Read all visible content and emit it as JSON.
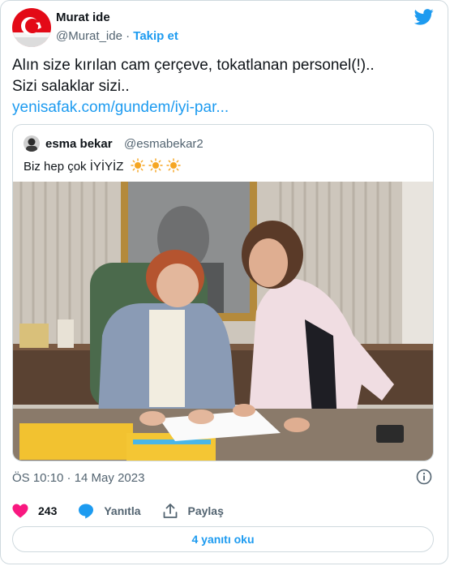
{
  "author": {
    "name": "Murat ide",
    "handle": "@Murat_ide",
    "separator": "·",
    "follow_label": "Takip et"
  },
  "tweet": {
    "line1": "Alın size kırılan cam çerçeve, tokatlanan personel(!)..",
    "line2": "Sizi salaklar sizi..",
    "link": "yenisafak.com/gundem/iyi-par..."
  },
  "quoted": {
    "name": "esma bekar",
    "handle": "@esmabekar2",
    "text": "Biz hep çok İYİYİZ",
    "text_icons": [
      "sun-icon",
      "sun-icon",
      "sun-icon"
    ]
  },
  "timestamp": "ÖS 10:10 · 14 May 2023",
  "actions": {
    "likes": "243",
    "reply_label": "Yanıtla",
    "share_label": "Paylaş"
  },
  "read_replies_label": "4 yanıtı oku",
  "colors": {
    "accent": "#1d9bf0",
    "like": "#f91880",
    "muted": "#536471",
    "border": "#cfd9de"
  }
}
